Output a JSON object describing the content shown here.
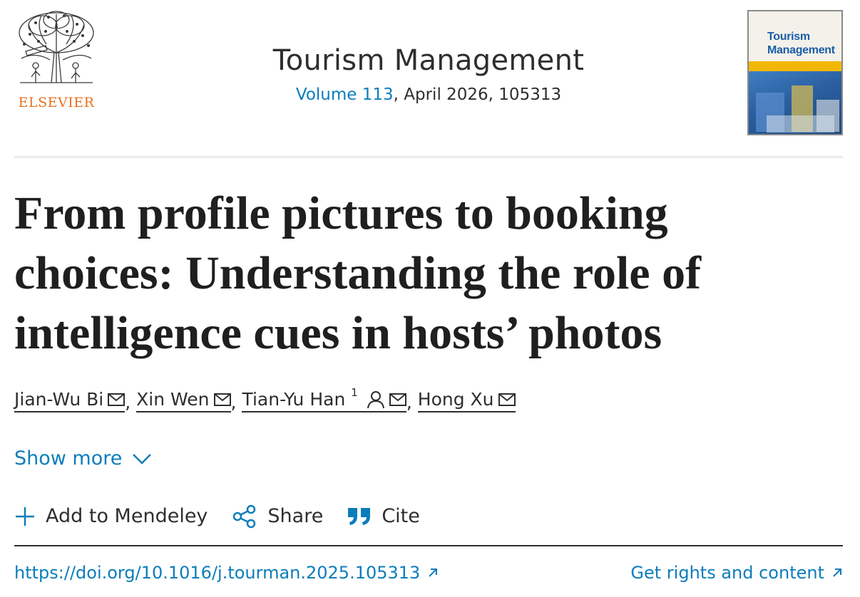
{
  "publisher": {
    "name": "ELSEVIER",
    "logo_icon": "elsevier-tree-logo",
    "brand_color": "#e9711c"
  },
  "journal": {
    "title": "Tourism Management",
    "volume_link": "Volume 113",
    "issue_info": ", April 2026, 105313",
    "cover_title_line1": "Tourism",
    "cover_title_line2": "Management"
  },
  "article": {
    "title": "From profile pictures to booking choices: Understanding the role of intelligence cues in hosts’ photos"
  },
  "authors": [
    {
      "name": "Jian-Wu Bi",
      "sep": ",",
      "icons": [
        "envelope-icon"
      ]
    },
    {
      "name": "Xin Wen",
      "sep": ",",
      "icons": [
        "envelope-icon"
      ]
    },
    {
      "name": "Tian-Yu Han",
      "sup": "1",
      "sep": ",",
      "icons": [
        "person-icon",
        "envelope-icon"
      ]
    },
    {
      "name": "Hong Xu",
      "sep": "",
      "icons": [
        "envelope-icon"
      ]
    }
  ],
  "show_more": {
    "label": "Show more",
    "icon": "chevron-down-icon"
  },
  "toolbar": {
    "mendeley": {
      "label": "Add to Mendeley",
      "icon": "plus-icon"
    },
    "share": {
      "label": "Share",
      "icon": "share-icon"
    },
    "cite": {
      "label": "Cite",
      "icon": "quote-icon"
    }
  },
  "links": {
    "doi": "https://doi.org/10.1016/j.tourman.2025.105313",
    "rights": "Get rights and content"
  },
  "colors": {
    "link": "#0c7dbb",
    "text": "#1f1f1f",
    "divider": "#ebebeb",
    "cover_band": "#f2b705",
    "cover_title": "#1a5ea8"
  }
}
